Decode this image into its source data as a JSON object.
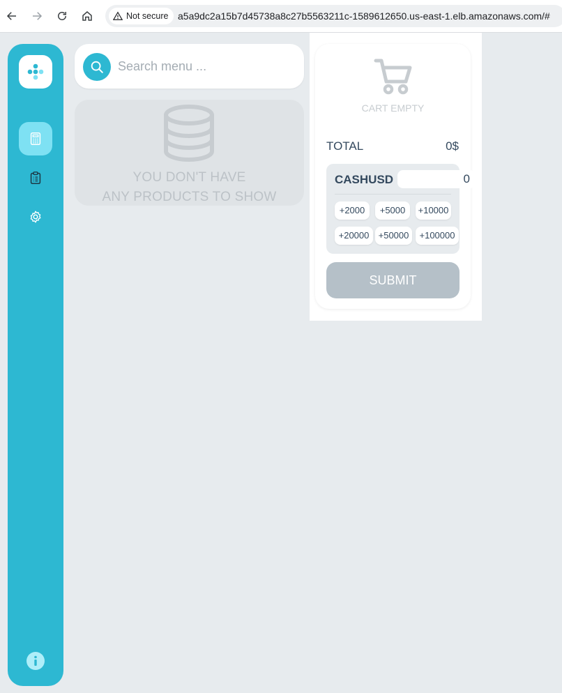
{
  "browser": {
    "security_label": "Not secure",
    "url": "a5a9dc2a15b7d45738a8c27b5563211c-1589612650.us-east-1.elb.amazonaws.com/#"
  },
  "sidebar": {
    "accent": "#2db8d2",
    "items": [
      {
        "icon": "calculator-icon",
        "active": true
      },
      {
        "icon": "clipboard-icon",
        "active": false
      },
      {
        "icon": "gear-icon",
        "active": false
      }
    ],
    "footer_icon": "info-icon"
  },
  "search": {
    "placeholder": "Search menu ..."
  },
  "products": {
    "empty_line1": "YOU DON'T HAVE",
    "empty_line2": "ANY PRODUCTS TO SHOW"
  },
  "cart": {
    "empty_label": "CART EMPTY",
    "total_label": "TOTAL",
    "total_value": "0$",
    "cash_label": "CASHUSD",
    "cash_value": "0",
    "quick_amounts": [
      "+2000",
      "+5000",
      "+10000",
      "+20000",
      "+50000",
      "+100000"
    ],
    "submit_label": "SUBMIT"
  }
}
